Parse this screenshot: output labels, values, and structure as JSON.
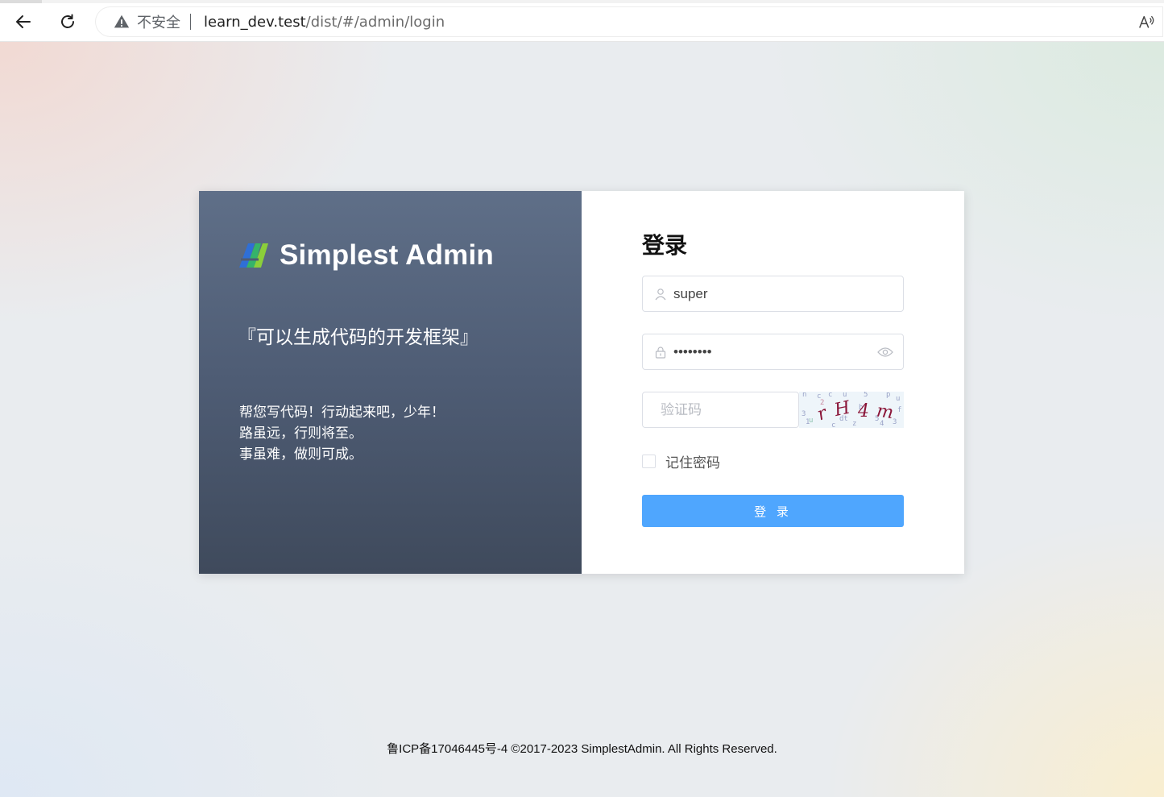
{
  "browser": {
    "security_label": "不安全",
    "url_host": "learn_dev.test",
    "url_path": "/dist/#/admin/login"
  },
  "brand": {
    "name": "Simplest Admin",
    "slogan": "『可以生成代码的开发框架』",
    "mottos": [
      "帮您写代码！行动起来吧，少年！",
      "路虽远，行则将至。",
      "事虽难，做则可成。"
    ],
    "logo_colors": [
      "#2f6fd6",
      "#35b36a",
      "#8bcf3a"
    ]
  },
  "login": {
    "title": "登录",
    "username_value": "super",
    "username_placeholder": "",
    "password_value": "••••••••",
    "captcha_placeholder": "验证码",
    "captcha_text": "rH4m",
    "remember_label": "记住密码",
    "submit_label": "登 录"
  },
  "footer": {
    "text": "鲁ICP备17046445号-4 ©2017-2023 SimplestAdmin. All Rights Reserved."
  },
  "colors": {
    "primary_button": "#4fa6fe",
    "left_panel_top": "#5f6f88",
    "left_panel_bottom": "#3f4a5c"
  }
}
